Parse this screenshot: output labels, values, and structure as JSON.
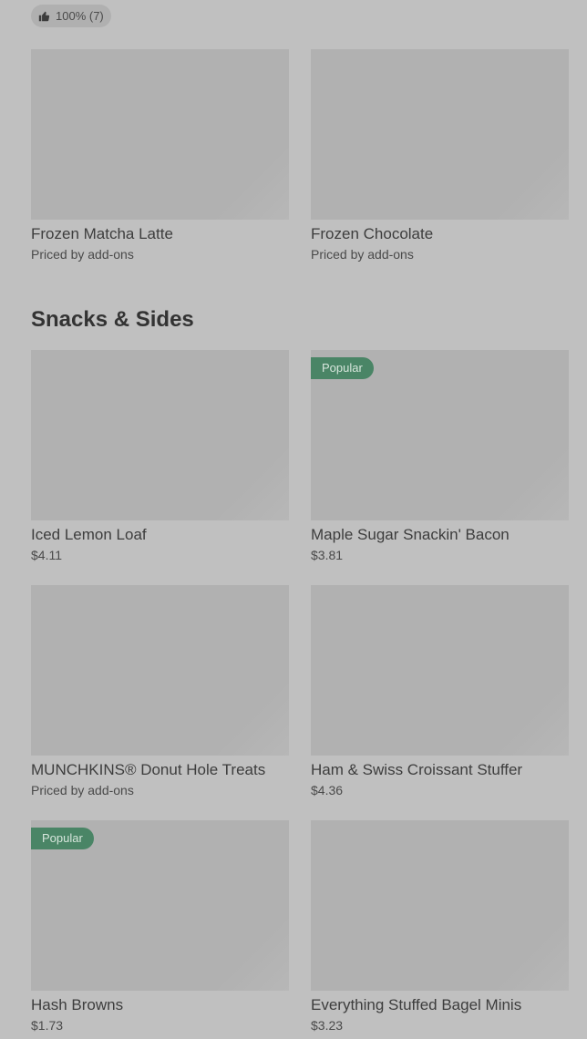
{
  "rating": {
    "label": "100% (7)"
  },
  "top_items": [
    {
      "name": "Frozen Matcha Latte",
      "price": "Priced by add-ons"
    },
    {
      "name": "Frozen Chocolate",
      "price": "Priced by add-ons"
    }
  ],
  "section": {
    "title": "Snacks & Sides"
  },
  "items": [
    {
      "name": "Iced Lemon Loaf",
      "price": "$4.11"
    },
    {
      "name": "Maple Sugar Snackin' Bacon",
      "price": "$3.81",
      "badge": "Popular"
    },
    {
      "name": "MUNCHKINS® Donut Hole Treats",
      "price": "Priced by add-ons"
    },
    {
      "name": "Ham & Swiss Croissant Stuffer",
      "price": "$4.36"
    },
    {
      "name": "Hash Browns",
      "price": "$1.73",
      "badge": "Popular"
    },
    {
      "name": "Everything Stuffed Bagel Minis",
      "price": "$3.23"
    }
  ],
  "colors": {
    "background": "#c0c0c0",
    "image_placeholder": "#b1b1b1",
    "badge": "#4a8566"
  }
}
